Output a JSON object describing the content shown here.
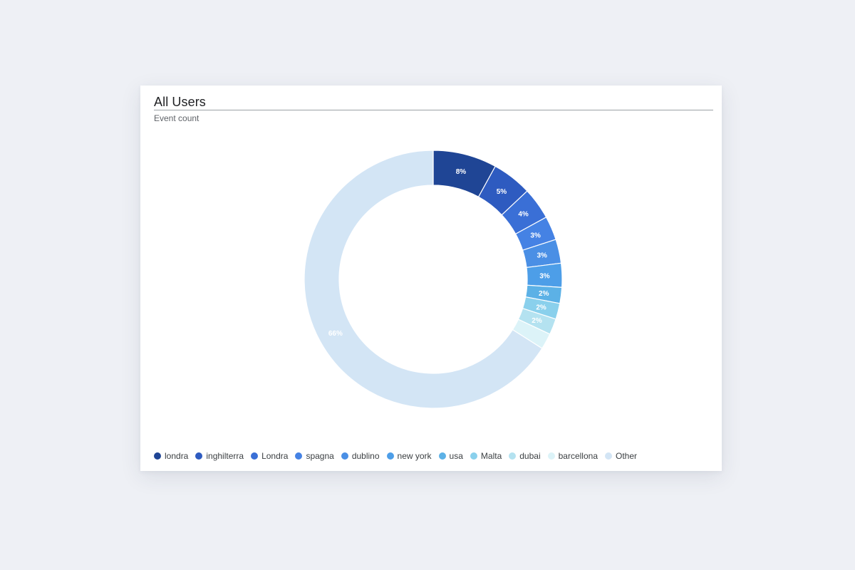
{
  "card": {
    "title": "All Users",
    "subtitle": "Event count"
  },
  "chart_data": {
    "type": "pie",
    "donut": true,
    "title": "All Users",
    "subtitle": "Event count",
    "legend_position": "bottom-left",
    "categories": [
      "londra",
      "inghilterra",
      "Londra",
      "spagna",
      "dublino",
      "new york",
      "usa",
      "Malta",
      "dubai",
      "barcellona",
      "Other"
    ],
    "values": [
      8,
      5,
      4,
      3,
      3,
      3,
      2,
      2,
      2,
      2,
      66
    ],
    "labels": [
      "8%",
      "5%",
      "4%",
      "3%",
      "3%",
      "3%",
      "2%",
      "2%",
      "2%",
      "",
      "66%"
    ],
    "colors": [
      "#1f4595",
      "#2e5bc0",
      "#3a6fd6",
      "#4582e4",
      "#4a8fe5",
      "#4d9ee8",
      "#5cb1e6",
      "#8ad0ec",
      "#b4e2f0",
      "#dcf3f8",
      "#d3e5f5"
    ]
  }
}
